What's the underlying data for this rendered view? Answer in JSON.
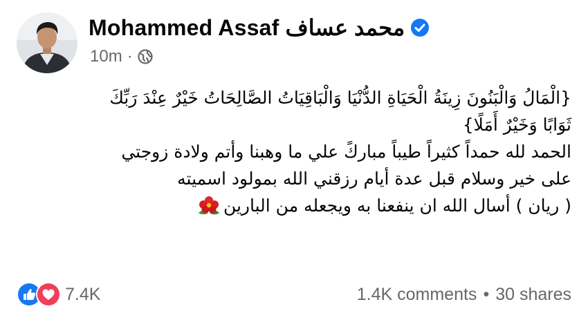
{
  "post": {
    "author": "Mohammed Assaf محمد عساف",
    "time": "10m",
    "meta_separator": "·",
    "audience_icon": "globe-icon",
    "verified_icon": "verified-badge-icon",
    "lines": [
      "{الْمَالُ وَالْبَنُونَ زِينَةُ الْحَيَاةِ الدُّنْيَا وَالْبَاقِيَاتُ الصَّالِحَاتُ خَيْرٌ عِنْدَ رَبِّكَ",
      "ثَوَابًا وَخَيْرٌ أَمَلًا}",
      "الحمد لله حمداً كثيراً طيباً مباركً علي ما وهبنا وأتم ولادة زوجتي",
      "على خير وسلام  قبل عدة أيام رزقني الله بمولود اسميته",
      "( ريان ) أسال الله ان ينفعنا به ويجعله من البارين"
    ],
    "emoji_icon": "hibiscus-icon"
  },
  "footer": {
    "reactions_count": "7.4K",
    "reaction_icons": [
      "like-icon",
      "love-icon"
    ],
    "comments": "1.4K comments",
    "separator": "•",
    "shares": "30 shares"
  },
  "colors": {
    "text": "#050505",
    "secondary": "#65676b",
    "facebook_blue": "#1877f2",
    "love_red": "#f33e58",
    "background": "#ffffff"
  }
}
